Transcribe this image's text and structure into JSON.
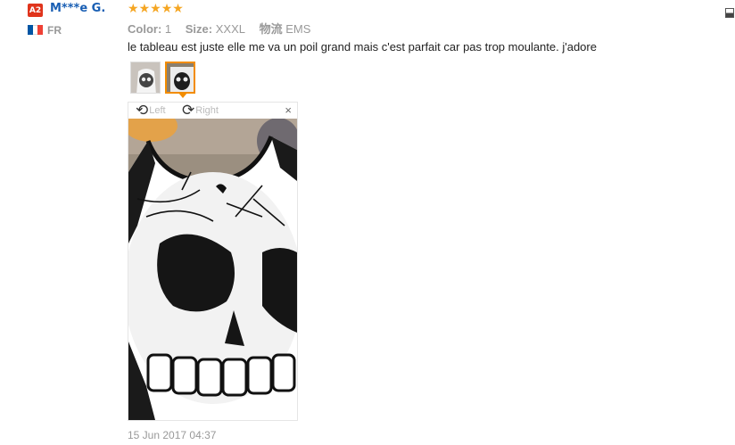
{
  "reviewer": {
    "badge": "A2",
    "name": "M***e G.",
    "country": "FR",
    "flag_colors": [
      "#0055a4",
      "#ffffff",
      "#ef4135"
    ]
  },
  "rating": {
    "stars": 5,
    "max": 5,
    "star_color": "#f5a623"
  },
  "attributes": {
    "color_label": "Color:",
    "color_value": "1",
    "size_label": "Size:",
    "size_value": "XXXL",
    "shipping_label": "物流",
    "shipping_value": "EMS"
  },
  "comment": "le tableau est juste elle me va un poil grand mais c'est parfait car pas trop moulante. j'adore",
  "thumbnails": {
    "count": 2,
    "selected_index": 1
  },
  "viewer": {
    "rotate_left_label": "Left",
    "rotate_right_label": "Right",
    "close_label": "×"
  },
  "date": "15 Jun 2017 04:37",
  "icons": {
    "rotate_left": "rotate-left-icon",
    "rotate_right": "rotate-right-icon",
    "close": "close-icon",
    "star": "star-icon"
  }
}
